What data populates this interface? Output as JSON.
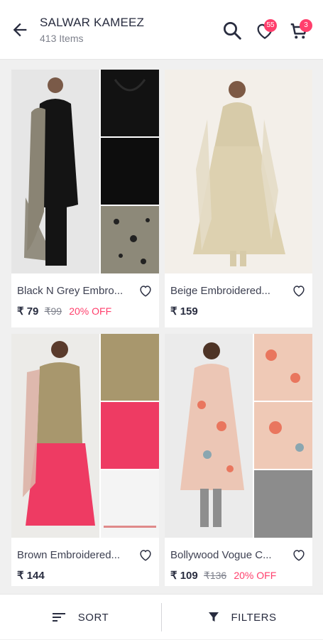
{
  "header": {
    "title": "SALWAR KAMEEZ",
    "subtitle": "413 Items",
    "wishlist_count": "55",
    "cart_count": "3"
  },
  "products": [
    {
      "name": "Black N Grey Embro...",
      "price": "₹ 79",
      "mrp": "₹99",
      "discount": "20% OFF",
      "image": "black-grey-embroidered-suit"
    },
    {
      "name": "Beige Embroidered...",
      "price": "₹ 159",
      "mrp": "",
      "discount": "",
      "image": "beige-embroidered-suit"
    },
    {
      "name": "Brown Embroidered...",
      "price": "₹ 144",
      "mrp": "",
      "discount": "",
      "image": "brown-embroidered-suit"
    },
    {
      "name": "Bollywood Vogue C...",
      "price": "₹ 109",
      "mrp": "₹136",
      "discount": "20% OFF",
      "image": "bollywood-vogue-suit"
    }
  ],
  "bottom_bar": {
    "sort_label": "SORT",
    "filter_label": "FILTERS"
  },
  "colors": {
    "accent": "#ff3f6c",
    "text": "#282c3f",
    "muted": "#7e818c"
  }
}
